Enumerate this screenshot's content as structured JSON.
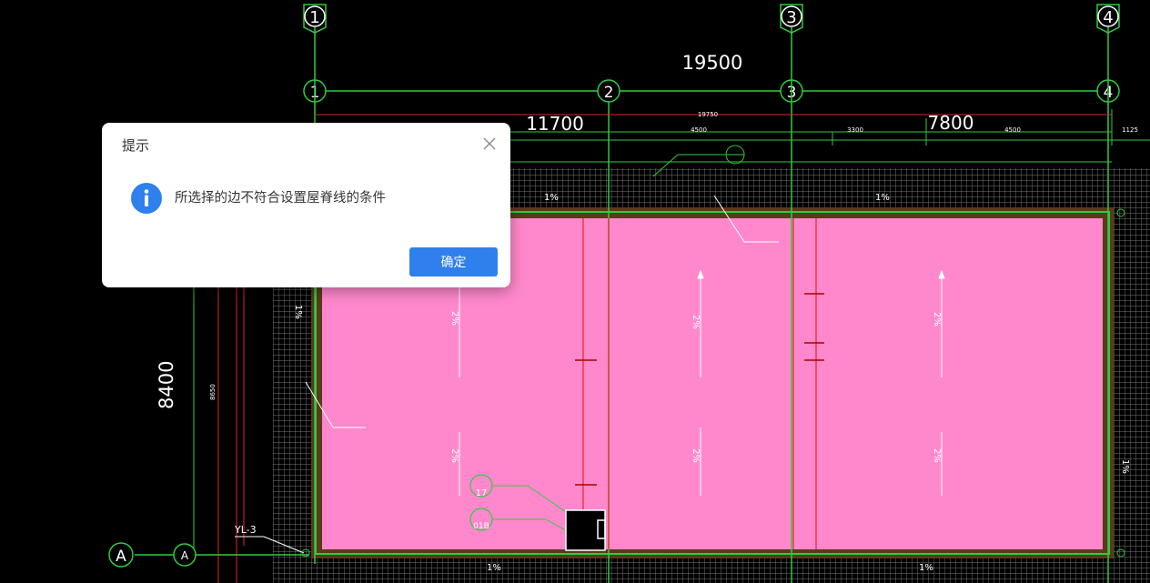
{
  "dialog": {
    "title": "提示",
    "message": "所选择的边不符合设置屋脊线的条件",
    "ok_label": "确定",
    "icon": "info-icon",
    "close_icon": "close-icon",
    "accent": "#2f80ed"
  },
  "drawing": {
    "axis_labels": {
      "a1": "1",
      "a3": "3",
      "a4": "4",
      "b1": "1",
      "b2": "2",
      "b3": "3",
      "b4": "4",
      "a": "A",
      "a_small": "A"
    },
    "dims": {
      "total": "19500",
      "span1": "11700",
      "span2": "7800",
      "small_total": "19750",
      "small_4500a": "4500",
      "small_3300": "3300",
      "small_4500b": "4500",
      "small_1125": "1125",
      "height": "8400",
      "height_small": "8650"
    },
    "beam_label": "YL-3",
    "slope_labels": [
      "2%",
      "2%",
      "2%",
      "2%",
      "2%",
      "2%"
    ],
    "edge_labels": [
      "1%",
      "1%",
      "1%",
      "1%",
      "1%",
      "1%"
    ],
    "callouts": [
      "17",
      "01B"
    ],
    "colors": {
      "roof_fill": "#ff88cc",
      "axis_line": "#2ecc40",
      "dim_line": "#39d353",
      "red_line": "#e8232a",
      "grid": "#aaaaaa"
    }
  }
}
